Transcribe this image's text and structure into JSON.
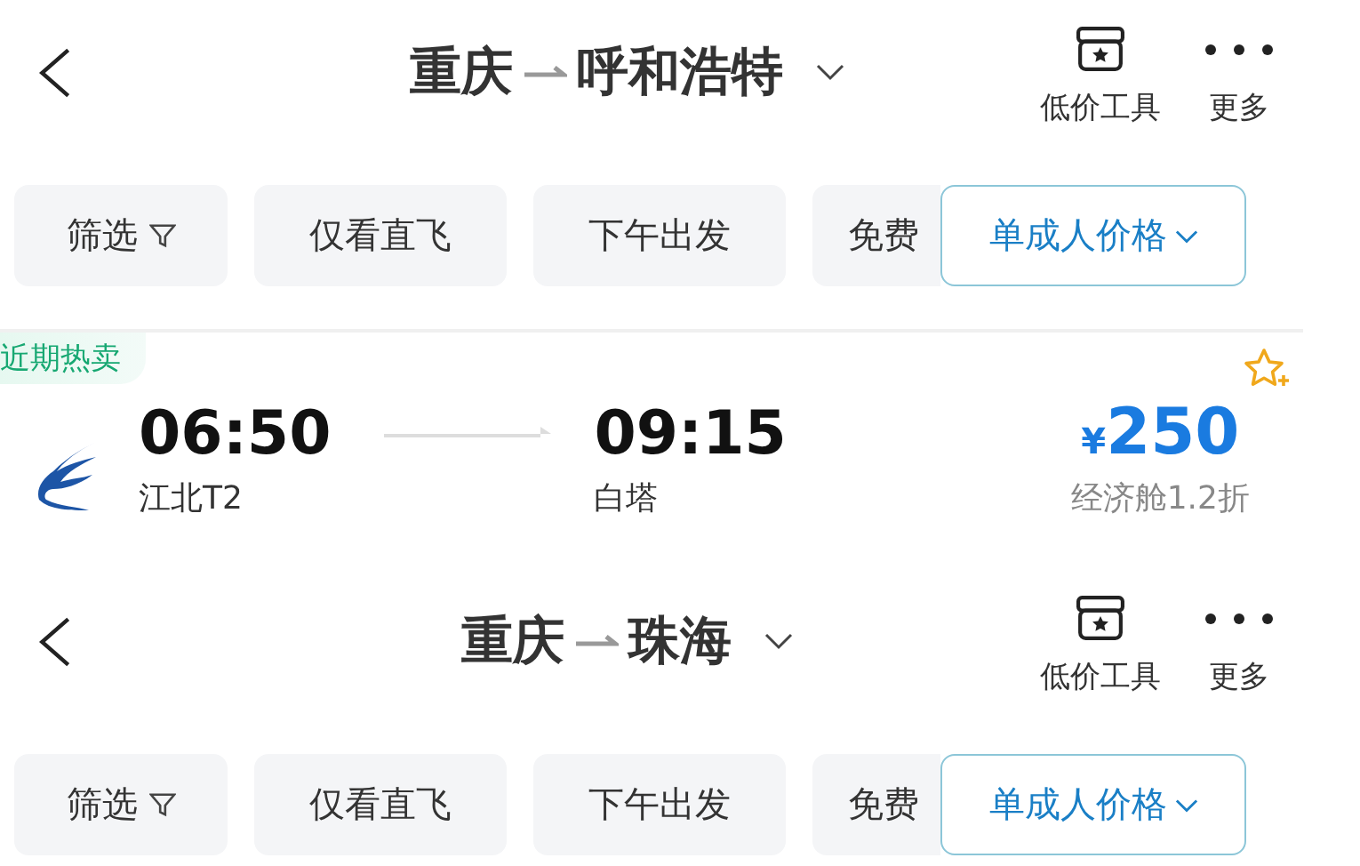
{
  "sections": [
    {
      "kind": "header",
      "origin": "重庆",
      "destination": "呼和浩特",
      "actions": [
        {
          "kind": "tools",
          "label": "低价工具"
        },
        {
          "kind": "more",
          "label": "更多"
        }
      ],
      "filters": [
        {
          "label": "筛选",
          "kind": "filter"
        },
        {
          "label": "仅看直飞",
          "kind": "plain"
        },
        {
          "label": "下午出发",
          "kind": "plain"
        },
        {
          "label": "免费",
          "kind": "plain"
        }
      ],
      "price_mode": "单成人价格"
    },
    {
      "kind": "flight",
      "badge": "近期热卖",
      "depart_time": "06:50",
      "depart_airport": "江北T2",
      "arrive_time": "09:15",
      "arrive_airport": "白塔",
      "currency": "¥",
      "price": "250",
      "fare_note": "经济舱1.2折"
    },
    {
      "kind": "header",
      "origin": "重庆",
      "destination": "珠海",
      "actions": [
        {
          "kind": "tools",
          "label": "低价工具"
        },
        {
          "kind": "more",
          "label": "更多"
        }
      ],
      "filters": [
        {
          "label": "筛选",
          "kind": "filter"
        },
        {
          "label": "仅看直飞",
          "kind": "plain"
        },
        {
          "label": "下午出发",
          "kind": "plain"
        },
        {
          "label": "免费",
          "kind": "plain"
        }
      ],
      "price_mode": "单成人价格"
    }
  ]
}
